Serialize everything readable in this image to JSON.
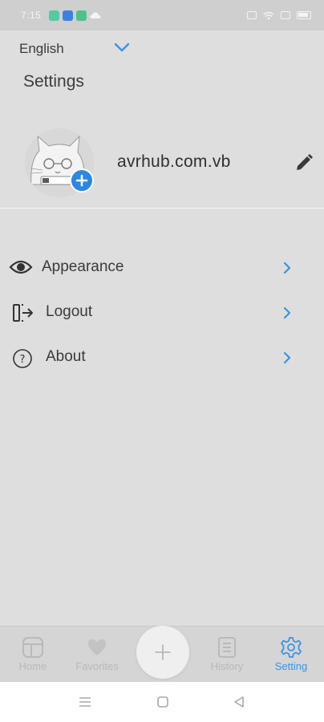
{
  "status_bar": {
    "time": "7:15",
    "app_icons": [
      {
        "name": "app-notification-1-icon",
        "color": "#57c9a0"
      },
      {
        "name": "app-notification-2-icon",
        "color": "#3b82e0"
      },
      {
        "name": "app-notification-3-icon",
        "color": "#4fc28a"
      },
      {
        "name": "cloud-icon",
        "color": "#f4f4f4"
      }
    ]
  },
  "language": {
    "selected": "English"
  },
  "page": {
    "title": "Settings"
  },
  "profile": {
    "username": "avrhub.com.vb"
  },
  "menu": {
    "items": [
      {
        "key": "appearance",
        "label": "Appearance",
        "icon": "eye-icon"
      },
      {
        "key": "logout",
        "label": "Logout",
        "icon": "logout-icon"
      },
      {
        "key": "about",
        "label": "About",
        "icon": "question-circle-icon"
      }
    ]
  },
  "bottom_nav": {
    "items": [
      {
        "key": "home",
        "label": "Home",
        "icon": "home-icon",
        "active": false
      },
      {
        "key": "favorites",
        "label": "Favorites",
        "icon": "heart-icon",
        "active": false
      },
      {
        "key": "history",
        "label": "History",
        "icon": "history-icon",
        "active": false
      },
      {
        "key": "setting",
        "label": "Setting",
        "icon": "gear-icon",
        "active": true
      }
    ],
    "fab_icon": "plus-icon"
  },
  "colors": {
    "accent": "#3a93e6",
    "avatar_badge": "#2b87e3",
    "background": "#dedede"
  }
}
